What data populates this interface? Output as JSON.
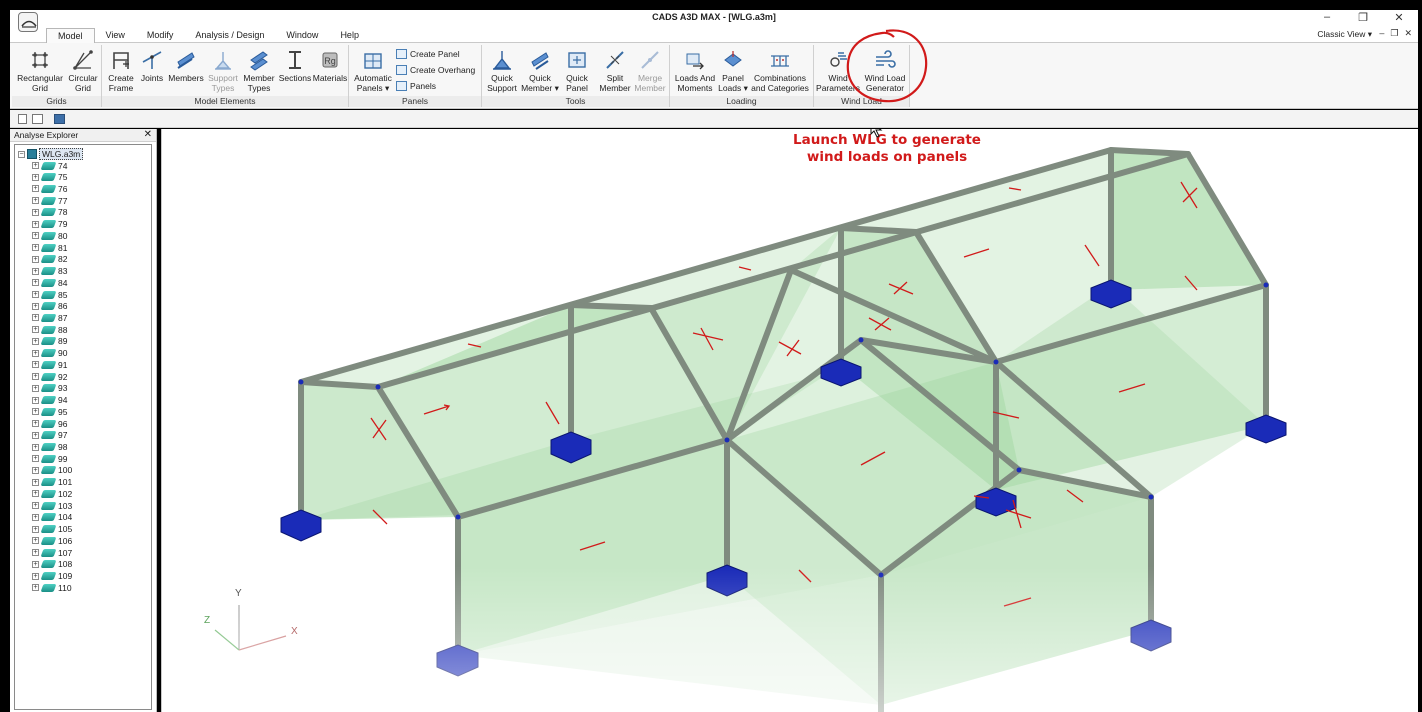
{
  "window": {
    "title": "CADS A3D MAX - [WLG.a3m]",
    "controls": [
      "–",
      "❐",
      "✕"
    ]
  },
  "menu": {
    "tabs": [
      "Model",
      "View",
      "Modify",
      "Analysis / Design",
      "Window",
      "Help"
    ],
    "active_tab": "Model",
    "classic_view": "Classic View",
    "mdi_controls": [
      "–",
      "❐",
      "✕"
    ]
  },
  "ribbon": {
    "groups": {
      "grids": "Grids",
      "model_elements": "Model Elements",
      "panels": "Panels",
      "tools": "Tools",
      "loading": "Loading",
      "wind_load": "Wind Load"
    },
    "buttons": {
      "rectangular_grid": [
        "Rectangular",
        "Grid"
      ],
      "circular_grid": [
        "Circular",
        "Grid"
      ],
      "create_frame": [
        "Create",
        "Frame"
      ],
      "joints": [
        "Joints"
      ],
      "members": [
        "Members"
      ],
      "support_types": [
        "Support",
        "Types"
      ],
      "member_types": [
        "Member",
        "Types"
      ],
      "sections": [
        "Sections"
      ],
      "materials": [
        "Materials"
      ],
      "automatic_panels": [
        "Automatic",
        "Panels ▾"
      ],
      "create_panel": "Create Panel",
      "create_overhang": "Create Overhang",
      "panels": "Panels",
      "quick_support": [
        "Quick",
        "Support"
      ],
      "quick_member": [
        "Quick",
        "Member ▾"
      ],
      "quick_panel": [
        "Quick",
        "Panel"
      ],
      "split_member": [
        "Split",
        "Member"
      ],
      "merge_member": [
        "Merge",
        "Member"
      ],
      "loads_and_moments": [
        "Loads And",
        "Moments"
      ],
      "panel_loads": [
        "Panel",
        "Loads ▾"
      ],
      "combinations": [
        "Combinations",
        "and Categories"
      ],
      "wind_parameters": [
        "Wind",
        "Parameters"
      ],
      "wind_load_generator": [
        "Wind Load",
        "Generator"
      ]
    }
  },
  "explorer": {
    "title": "Analyse Explorer",
    "close": "✕",
    "root": "WLG.a3m",
    "items": [
      "74",
      "75",
      "76",
      "77",
      "78",
      "79",
      "80",
      "81",
      "82",
      "83",
      "84",
      "85",
      "86",
      "87",
      "88",
      "89",
      "90",
      "91",
      "92",
      "93",
      "94",
      "95",
      "96",
      "97",
      "98",
      "99",
      "100",
      "101",
      "102",
      "103",
      "104",
      "105",
      "106",
      "107",
      "108",
      "109",
      "110"
    ]
  },
  "viewport": {
    "callout": [
      "Launch WLG to generate",
      "wind loads on panels"
    ],
    "axes": {
      "x": "X",
      "y": "Y",
      "z": "Z"
    }
  },
  "colors": {
    "annotation": "#d11a1a",
    "panel_fill": "#8fcf8f",
    "member": "#8a958a",
    "support": "#1a2bb8"
  }
}
